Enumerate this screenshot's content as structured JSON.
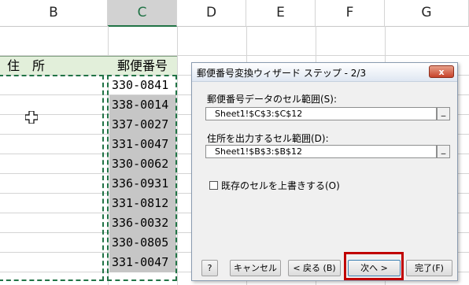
{
  "sheet": {
    "columns": [
      "B",
      "C",
      "D",
      "E",
      "F",
      "G"
    ],
    "active_column": "C",
    "header_b": "住　所",
    "header_c": "郵便番号",
    "zip_codes": [
      "330-0841",
      "338-0014",
      "337-0027",
      "331-0047",
      "330-0062",
      "336-0931",
      "331-0812",
      "336-0032",
      "330-0805",
      "331-0047"
    ],
    "colors": {
      "accent": "#217346",
      "header_fill": "#e2efda",
      "selection": "#c6c6c6"
    }
  },
  "dialog": {
    "title": "郵便番号変換ウィザード ステップ - 2/3",
    "close_label": "x",
    "zip_range_label": "郵便番号データのセル範囲(S):",
    "zip_range_value": "Sheet1!$C$3:$C$12",
    "addr_range_label": "住所を出力するセル範囲(D):",
    "addr_range_value": "Sheet1!$B$3:$B$12",
    "collapse_label": "_",
    "overwrite_label": "既存のセルを上書きする(O)",
    "overwrite_checked": false,
    "buttons": {
      "help": "?",
      "cancel": "キャンセル",
      "back": "< 戻る (B)",
      "next": "次へ >",
      "finish": "完了(F)"
    },
    "highlight_color": "#c00000"
  }
}
